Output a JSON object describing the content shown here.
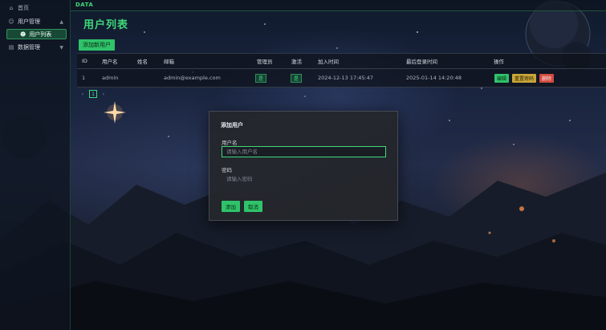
{
  "sidebar": {
    "home": "首页",
    "user_mgmt": "用户管理",
    "user_list": "用户列表",
    "data_mgmt": "数据管理"
  },
  "topbar": {
    "brand": "DATA"
  },
  "page": {
    "title": "用户列表",
    "add_button": "添加新用户"
  },
  "table": {
    "headers": [
      "ID",
      "用户名",
      "姓名",
      "邮箱",
      "管理员",
      "激活",
      "加入时间",
      "最后登录时间",
      "操作"
    ],
    "rows": [
      {
        "id": "1",
        "username": "admin",
        "name": "",
        "email": "admin@example.com",
        "is_admin": "是",
        "active": "是",
        "joined": "2024-12-13 17:45:47",
        "last_login": "2025-01-14 14:20:48",
        "actions": {
          "edit": "编辑",
          "reset": "重置密码",
          "delete": "删除"
        }
      }
    ]
  },
  "pagination": {
    "current": "1",
    "prev": "‹",
    "next": "›"
  },
  "modal": {
    "title": "添加用户",
    "username_label": "用户名",
    "username_placeholder": "请输入用户名",
    "password_label": "密码",
    "password_placeholder": "请输入密码",
    "submit": "添加",
    "cancel": "取消"
  },
  "colors": {
    "accent": "#3ed97a",
    "warning": "#c9a63a",
    "danger": "#d24a3f"
  }
}
